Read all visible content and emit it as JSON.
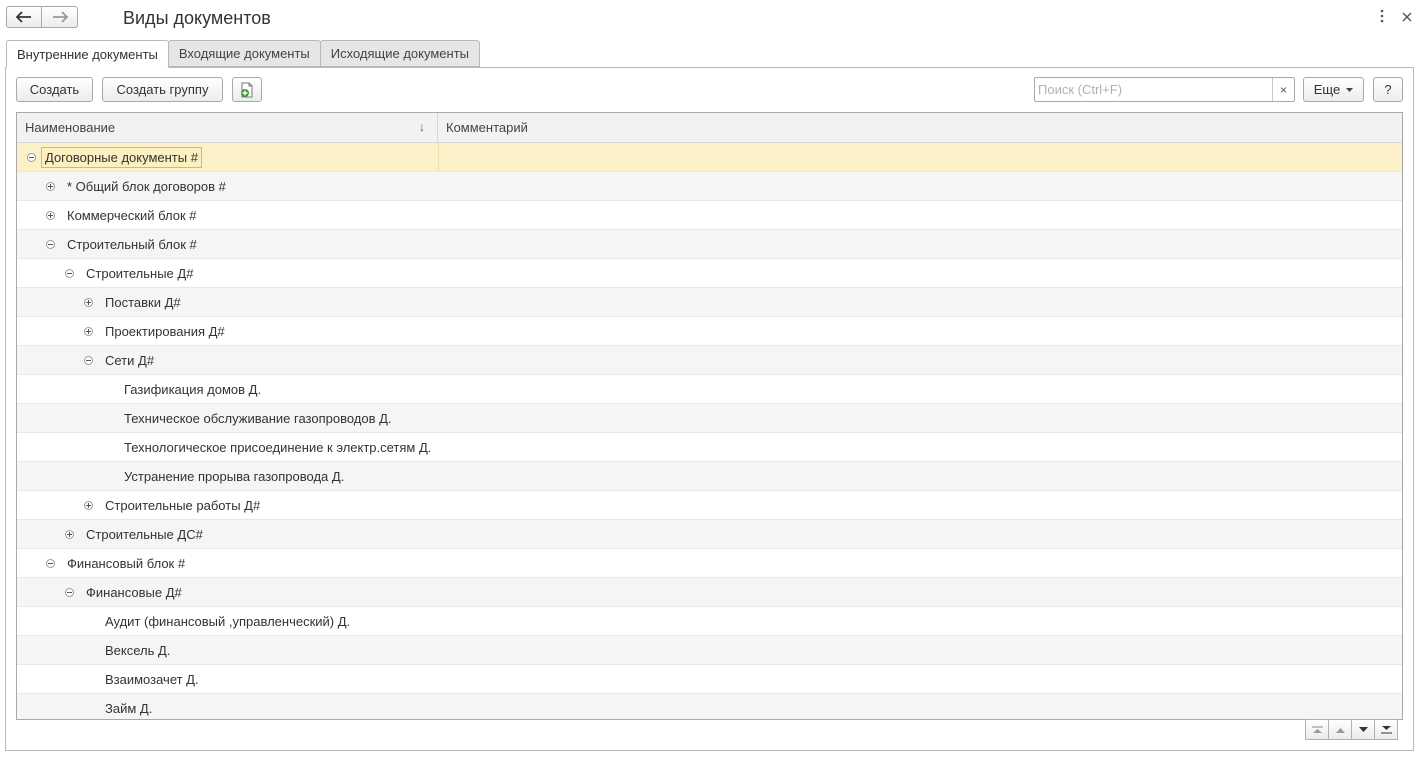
{
  "window": {
    "title": "Виды документов"
  },
  "icons": {
    "back": "arrow-left-icon",
    "forward": "arrow-right-icon",
    "more": "more-vertical-icon",
    "close": "close-icon",
    "create_file": "create-file-icon"
  },
  "tabs": [
    {
      "label": "Внутренние документы",
      "active": true
    },
    {
      "label": "Входящие документы",
      "active": false
    },
    {
      "label": "Исходящие документы",
      "active": false
    }
  ],
  "toolbar": {
    "create_label": "Создать",
    "create_group_label": "Создать группу",
    "search_placeholder": "Поиск (Ctrl+F)",
    "search_clear": "×",
    "more_label": "Еще",
    "help_label": "?"
  },
  "grid": {
    "columns": {
      "name": "Наименование",
      "comment": "Комментарий",
      "sort_indicator": "↓"
    },
    "rows": [
      {
        "label": "Договорные документы #",
        "level": 0,
        "toggle": "minus",
        "selected": true
      },
      {
        "label": "* Общий блок договоров #",
        "level": 1,
        "toggle": "plus"
      },
      {
        "label": "Коммерческий блок #",
        "level": 1,
        "toggle": "plus"
      },
      {
        "label": "Строительный блок #",
        "level": 1,
        "toggle": "minus"
      },
      {
        "label": "Строительные Д#",
        "level": 2,
        "toggle": "minus"
      },
      {
        "label": "Поставки Д#",
        "level": 3,
        "toggle": "plus"
      },
      {
        "label": "Проектирования Д#",
        "level": 3,
        "toggle": "plus"
      },
      {
        "label": "Сети Д#",
        "level": 3,
        "toggle": "minus"
      },
      {
        "label": "Газификация домов Д.",
        "level": 4,
        "toggle": "none"
      },
      {
        "label": "Техническое обслуживание газопроводов Д.",
        "level": 4,
        "toggle": "none"
      },
      {
        "label": "Технологическое присоединение к электр.сетям Д.",
        "level": 4,
        "toggle": "none"
      },
      {
        "label": "Устранение прорыва газопровода Д.",
        "level": 4,
        "toggle": "none"
      },
      {
        "label": "Строительные работы Д#",
        "level": 3,
        "toggle": "plus"
      },
      {
        "label": "Строительные ДС#",
        "level": 2,
        "toggle": "plus"
      },
      {
        "label": "Финансовый блок #",
        "level": 1,
        "toggle": "minus"
      },
      {
        "label": "Финансовые Д#",
        "level": 2,
        "toggle": "minus"
      },
      {
        "label": "Аудит (финансовый ,управленческий) Д.",
        "level": 3,
        "toggle": "none"
      },
      {
        "label": "Вексель Д.",
        "level": 3,
        "toggle": "none"
      },
      {
        "label": "Взаимозачет Д.",
        "level": 3,
        "toggle": "none"
      },
      {
        "label": "Займ Д.",
        "level": 3,
        "toggle": "none"
      }
    ]
  },
  "pager": [
    "scroll-to-top-icon",
    "scroll-up-icon",
    "scroll-down-icon",
    "scroll-to-bottom-icon"
  ]
}
